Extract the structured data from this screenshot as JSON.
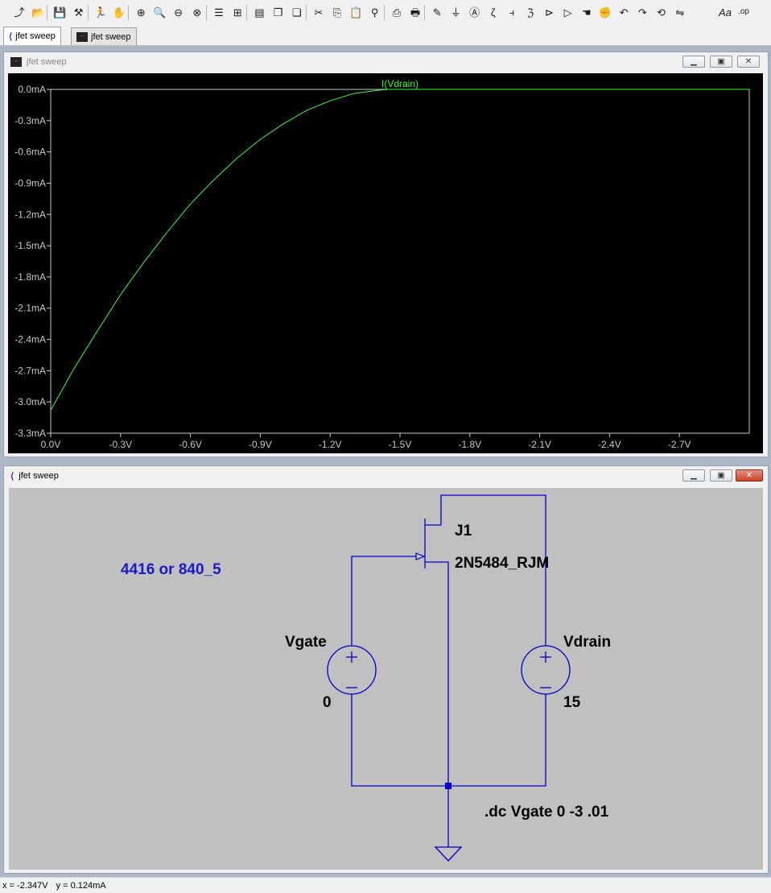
{
  "toolbar": {
    "icons": [
      "open-schematic-icon",
      "open-folder-icon",
      "save-icon",
      "control-panel-icon",
      "run-icon",
      "halt-icon",
      "zoom-in-icon",
      "zoom-pan-icon",
      "zoom-out-icon",
      "zoom-cancel-icon",
      "autorange-icon",
      "grid-icon",
      "tile-horizontal-icon",
      "cascade-icon",
      "close-windows-icon",
      "cut-icon",
      "copy-icon",
      "paste-icon",
      "find-icon",
      "print-setup-icon",
      "print-icon",
      "wire-icon",
      "ground-icon",
      "label-icon",
      "resistor-icon",
      "capacitor-icon",
      "inductor-icon",
      "diode-icon",
      "component-icon",
      "move-icon",
      "drag-icon",
      "undo-icon",
      "redo-icon",
      "rotate-icon",
      "mirror-icon"
    ],
    "text_tool": "Aa",
    "op_tool": ".op"
  },
  "tabs": [
    {
      "label": "jfet sweep",
      "icon": "schematic-icon",
      "active": true
    },
    {
      "label": "jfet sweep",
      "icon": "waveform-icon",
      "active": false
    }
  ],
  "plot_window": {
    "title": "jfet sweep",
    "trace_label": "I(Vdrain)",
    "trace_color": "#33ff33",
    "background": "#000000"
  },
  "schematic_window": {
    "title": "jfet sweep",
    "comment": "4416 or 840_5",
    "jfet": {
      "name": "J1",
      "model": "2N5484_RJM"
    },
    "vgate": {
      "name": "Vgate",
      "value": "0"
    },
    "vdrain": {
      "name": "Vdrain",
      "value": "15"
    },
    "directive": ".dc Vgate 0 -3 .01",
    "wire_color": "#0000c8",
    "background": "#c0c0c0"
  },
  "status": {
    "x": "x = -2.347V",
    "y": "y = 0.124mA"
  },
  "chart_data": {
    "type": "line",
    "title": "",
    "series": [
      {
        "name": "I(Vdrain)",
        "x": [
          0,
          -0.1,
          -0.2,
          -0.3,
          -0.4,
          -0.5,
          -0.6,
          -0.7,
          -0.8,
          -0.9,
          -1.0,
          -1.1,
          -1.2,
          -1.3,
          -1.4,
          -1.45,
          -1.5,
          -3.0
        ],
        "y": [
          -3.08,
          -2.68,
          -2.32,
          -1.97,
          -1.66,
          -1.37,
          -1.1,
          -0.87,
          -0.66,
          -0.48,
          -0.33,
          -0.2,
          -0.11,
          -0.04,
          -0.01,
          0.0,
          0.0,
          0.0
        ]
      }
    ],
    "xlim": [
      0,
      -3.0
    ],
    "ylim": [
      -3.3,
      0.0
    ],
    "xticks": [
      {
        "v": 0,
        "label": "0.0V"
      },
      {
        "v": -0.3,
        "label": "-0.3V"
      },
      {
        "v": -0.6,
        "label": "-0.6V"
      },
      {
        "v": -0.9,
        "label": "-0.9V"
      },
      {
        "v": -1.2,
        "label": "-1.2V"
      },
      {
        "v": -1.5,
        "label": "-1.5V"
      },
      {
        "v": -1.8,
        "label": "-1.8V"
      },
      {
        "v": -2.1,
        "label": "-2.1V"
      },
      {
        "v": -2.4,
        "label": "-2.4V"
      },
      {
        "v": -2.7,
        "label": "-2.7V"
      }
    ],
    "yticks": [
      {
        "v": 0,
        "label": "0.0mA"
      },
      {
        "v": -0.3,
        "label": "-0.3mA"
      },
      {
        "v": -0.6,
        "label": "-0.6mA"
      },
      {
        "v": -0.9,
        "label": "-0.9mA"
      },
      {
        "v": -1.2,
        "label": "-1.2mA"
      },
      {
        "v": -1.5,
        "label": "-1.5mA"
      },
      {
        "v": -1.8,
        "label": "-1.8mA"
      },
      {
        "v": -2.1,
        "label": "-2.1mA"
      },
      {
        "v": -2.4,
        "label": "-2.4mA"
      },
      {
        "v": -2.7,
        "label": "-2.7mA"
      },
      {
        "v": -3.0,
        "label": "-3.0mA"
      },
      {
        "v": -3.3,
        "label": "-3.3mA"
      }
    ],
    "grid": false
  }
}
